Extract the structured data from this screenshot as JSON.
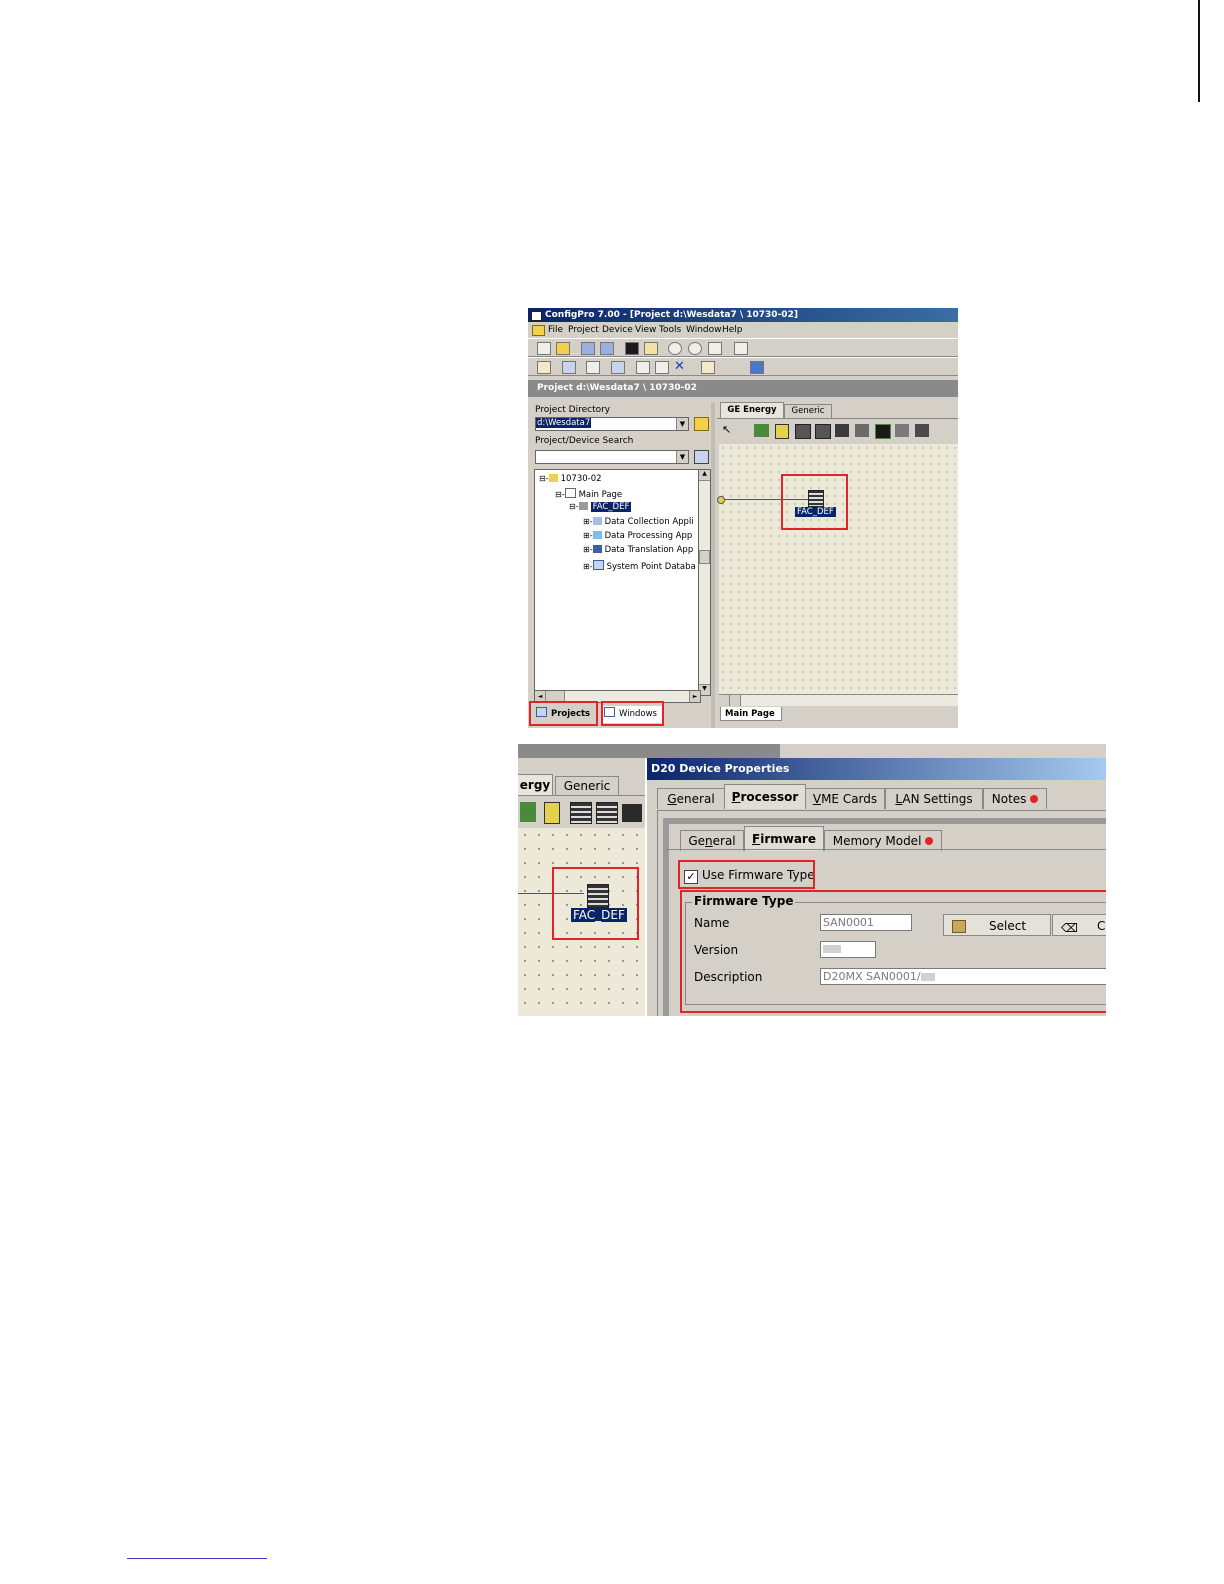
{
  "shot1": {
    "window_title": "ConfigPro 7.00 - [Project d:\\Wesdata7 \\ 10730-02]",
    "menu": [
      "File",
      "Project",
      "Device",
      "View",
      "Tools",
      "Window",
      "Help"
    ],
    "project_bar": "Project d:\\Wesdata7 \\ 10730-02",
    "project_directory_label": "Project Directory",
    "project_directory_value": "d:\\Wesdata7",
    "search_label": "Project/Device Search",
    "tree": {
      "root": "10730-02",
      "main_page": "Main Page",
      "device": "FAC_DEF",
      "children": [
        "Data Collection Appli",
        "Data Processing App",
        "Data Translation App",
        "System Point Databa"
      ]
    },
    "palette_tabs": [
      "GE Energy",
      "Generic"
    ],
    "canvas_device_label": "FAC_DEF",
    "bottom_tabs_left": [
      "Projects",
      "Windows"
    ],
    "bottom_tab_right": "Main Page"
  },
  "shot2": {
    "palette_tabs": [
      "ergy",
      "Generic"
    ],
    "canvas_device_label": "FAC_DEF",
    "dialog_title": "D20 Device Properties",
    "tabs": [
      "General",
      "Processor",
      "VME Cards",
      "LAN Settings",
      "Notes"
    ],
    "subtabs": [
      "General",
      "Firmware",
      "Memory Model"
    ],
    "use_firmware_label": "Use Firmware Type",
    "use_firmware_checked": true,
    "group_title": "Firmware Type",
    "name_label": "Name",
    "name_value": "SAN0001",
    "version_label": "Version",
    "description_label": "Description",
    "description_value": "D20MX SAN0001/",
    "select_button": "Select",
    "clear_button_partial": "Cl"
  },
  "colors": {
    "highlight_red": "#e0252a",
    "title_blue": "#0a246a"
  }
}
